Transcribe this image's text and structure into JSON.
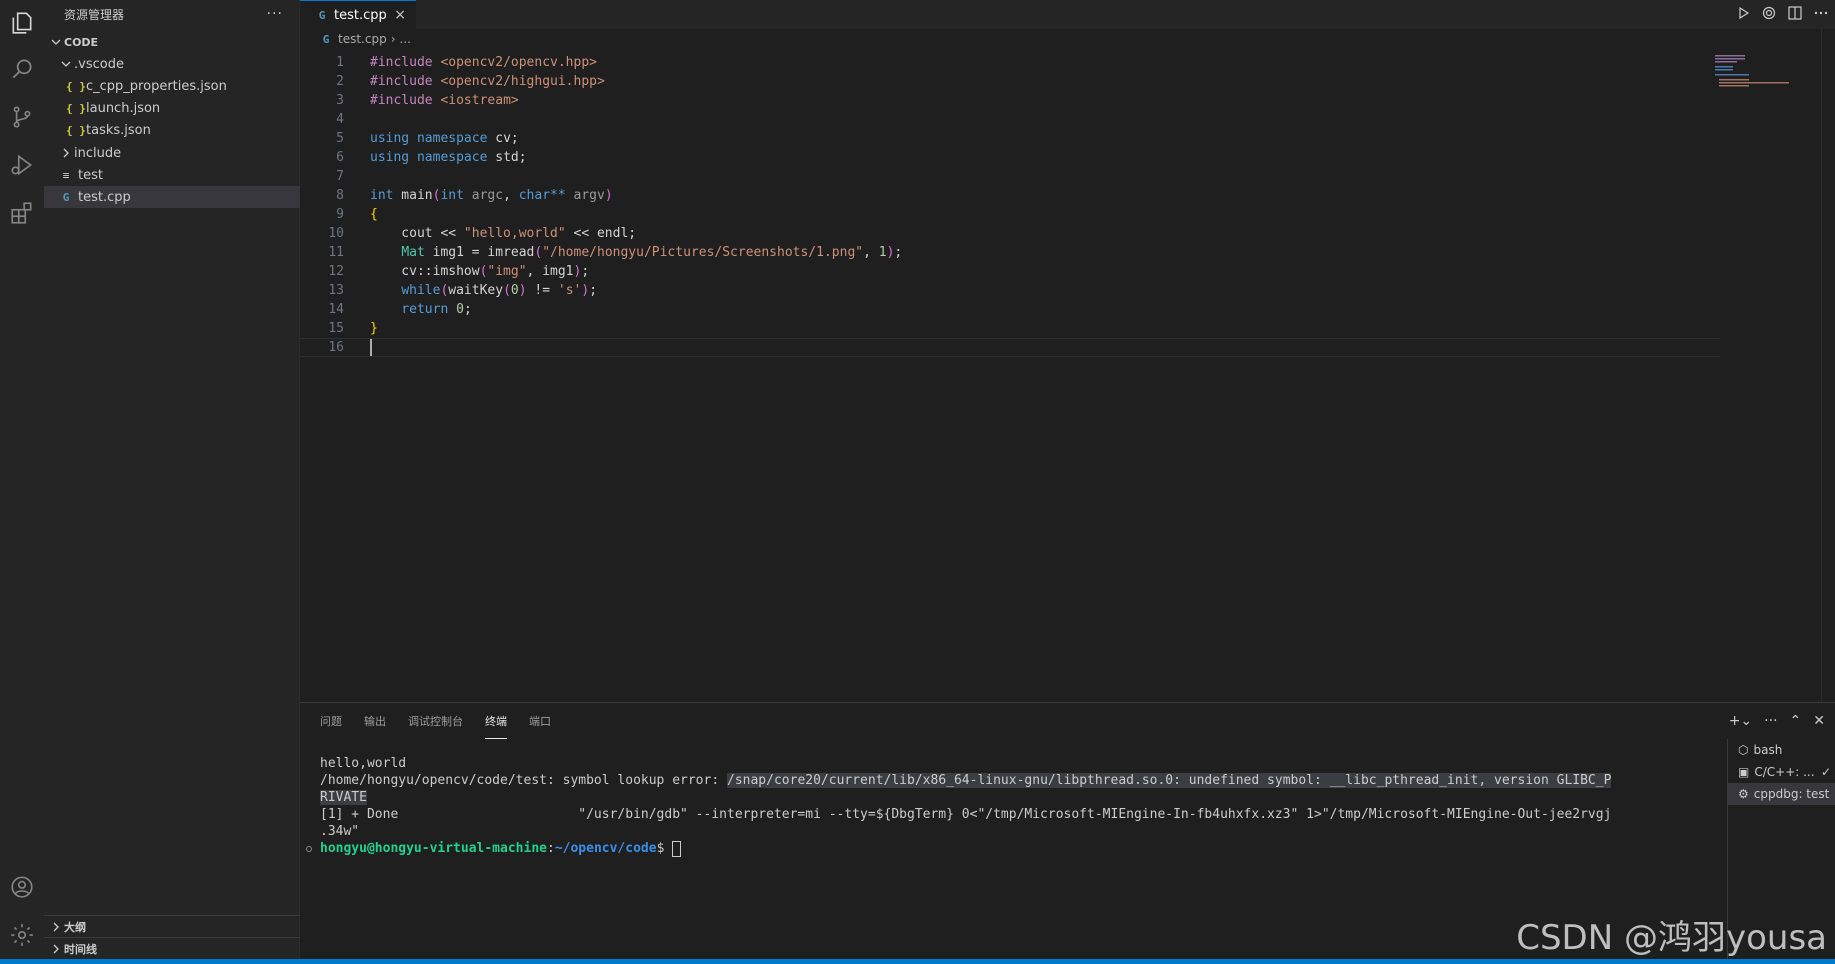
{
  "activity_bar": {
    "items": [
      "explorer-icon",
      "search-icon",
      "source-control-icon",
      "run-debug-icon",
      "extensions-icon"
    ],
    "bottom": [
      "account-icon",
      "manage-gear-icon"
    ]
  },
  "sidebar": {
    "title": "资源管理器",
    "more": "···",
    "root": "CODE",
    "items": [
      {
        "label": ".vscode",
        "icon": "chevron-down"
      },
      {
        "label": "c_cpp_properties.json",
        "icon": "{ }"
      },
      {
        "label": "launch.json",
        "icon": "{ }"
      },
      {
        "label": "tasks.json",
        "icon": "{ }"
      },
      {
        "label": "include",
        "icon": "chevron-right"
      },
      {
        "label": "test",
        "icon": "≡"
      },
      {
        "label": "test.cpp",
        "icon": "G"
      }
    ],
    "outline": "大纲",
    "timeline": "时间线"
  },
  "editor": {
    "tab": {
      "label": "test.cpp",
      "icon": "G",
      "close": "×"
    },
    "breadcrumb": {
      "file": "test.cpp",
      "sep": "›",
      "rest": "..."
    },
    "line_numbers": [
      "1",
      "2",
      "3",
      "4",
      "5",
      "6",
      "7",
      "8",
      "9",
      "10",
      "11",
      "12",
      "13",
      "14",
      "15",
      "16"
    ]
  },
  "panel": {
    "tabs": [
      "问题",
      "输出",
      "调试控制台",
      "终端",
      "端口"
    ],
    "active_tab": "终端",
    "terminal": {
      "line1": "hello,world",
      "line2a": "/home/hongyu/opencv/code/test: symbol lookup error: ",
      "line2b": "/snap/core20/current/lib/x86_64-linux-gnu/libpthread.so.0: undefined symbol: __libc_pthread_init, version GLIBC_P",
      "line3": "RIVATE",
      "line4": "[1] + Done                       \"/usr/bin/gdb\" --interpreter=mi --tty=${DbgTerm} 0<\"/tmp/Microsoft-MIEngine-In-fb4uhxfx.xz3\" 1>\"/tmp/Microsoft-MIEngine-Out-jee2rvgj",
      "line5": ".34w\"",
      "prompt_user": "hongyu@hongyu-virtual-machine",
      "prompt_sep": ":",
      "prompt_path": "~/opencv/code",
      "prompt_end": "$ "
    },
    "terminals": [
      "bash",
      "C/C++: ...",
      "cppdbg: test"
    ]
  },
  "watermark": "CSDN @鸿羽yousa"
}
